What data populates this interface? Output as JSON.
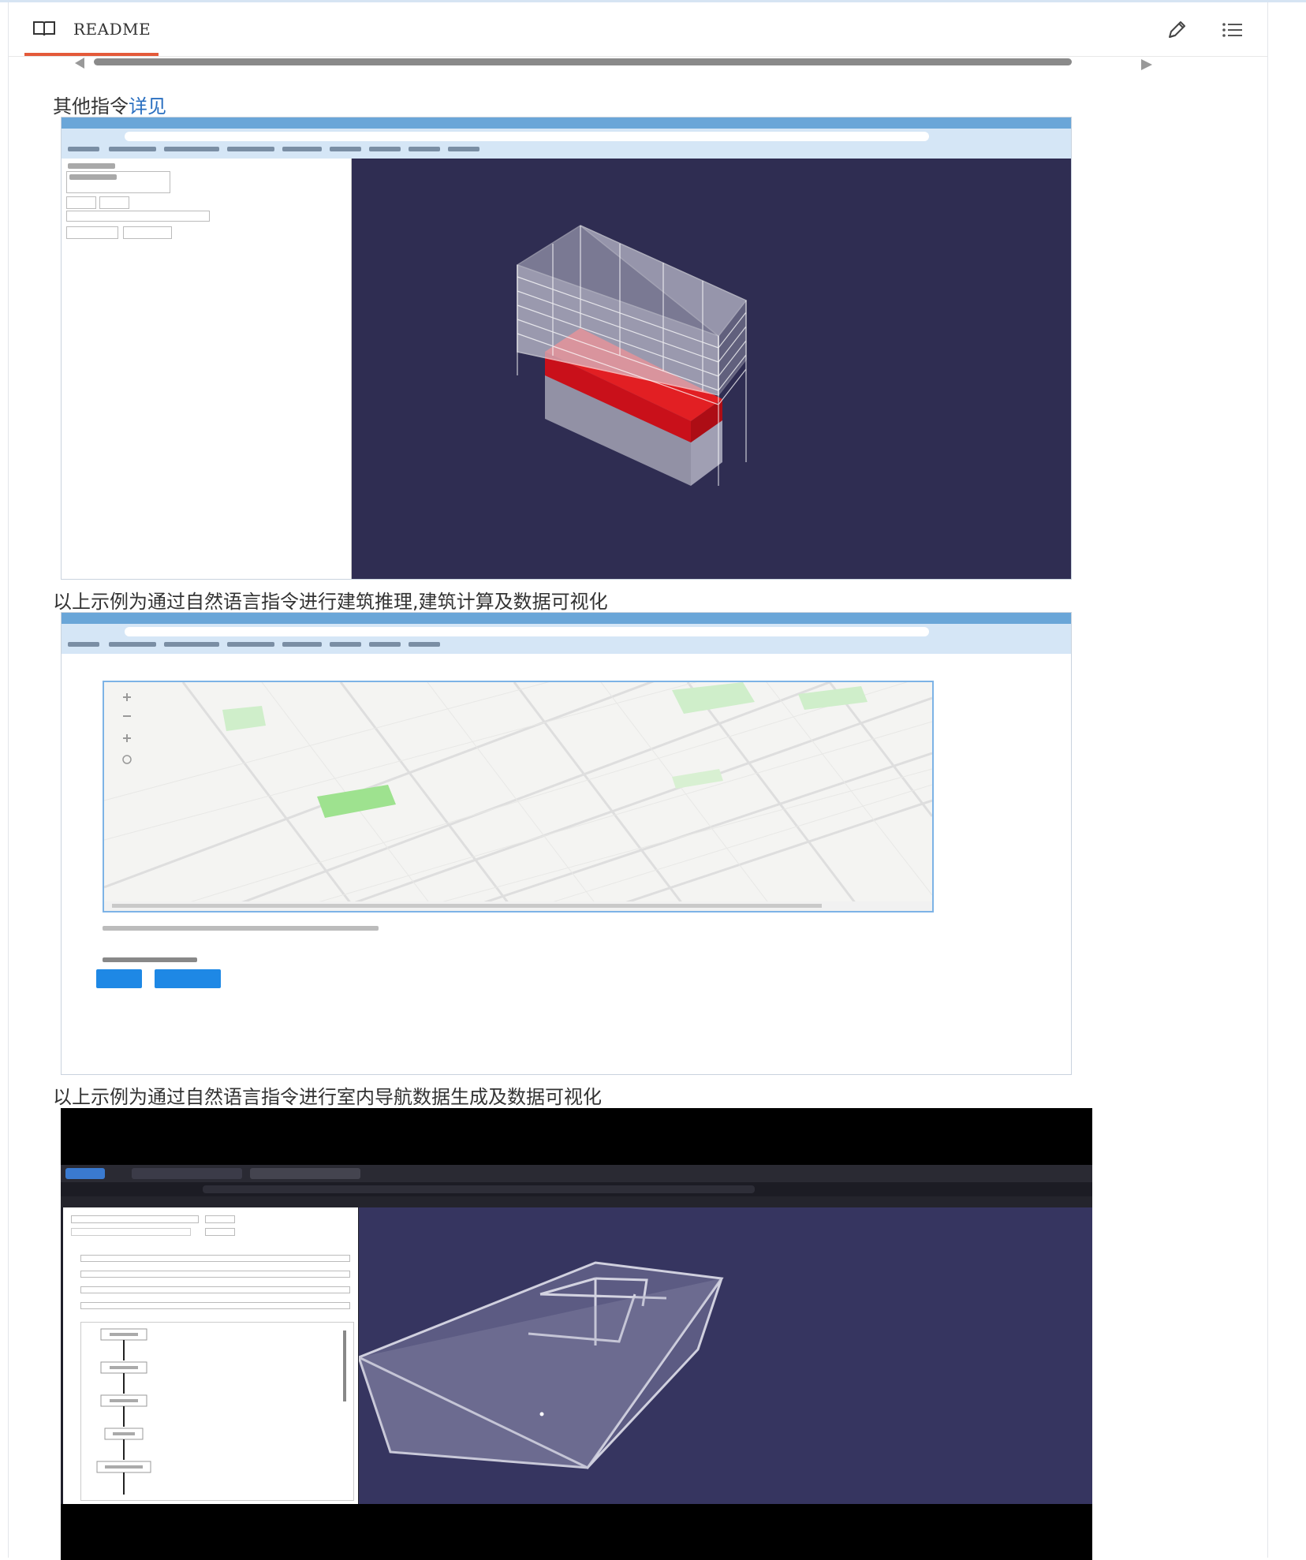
{
  "header": {
    "readme_label": "README",
    "icons": {
      "book": "book-icon",
      "edit": "pencil-icon",
      "toc": "list-icon"
    }
  },
  "content": {
    "line1_prefix": "其他指令",
    "line1_link": "详见",
    "caption1": "以上示例为通过自然语言指令进行建筑推理,建筑计算及数据可视化",
    "caption2": "以上示例为通过自然语言指令进行室内导航数据生成及数据可视化"
  },
  "colors": {
    "accent_underline": "#e45a3a",
    "link": "#2a6fc0",
    "scene_bg": "#2f2d52",
    "highlight_floor": "#d4141a",
    "button_blue": "#1e88e5"
  }
}
